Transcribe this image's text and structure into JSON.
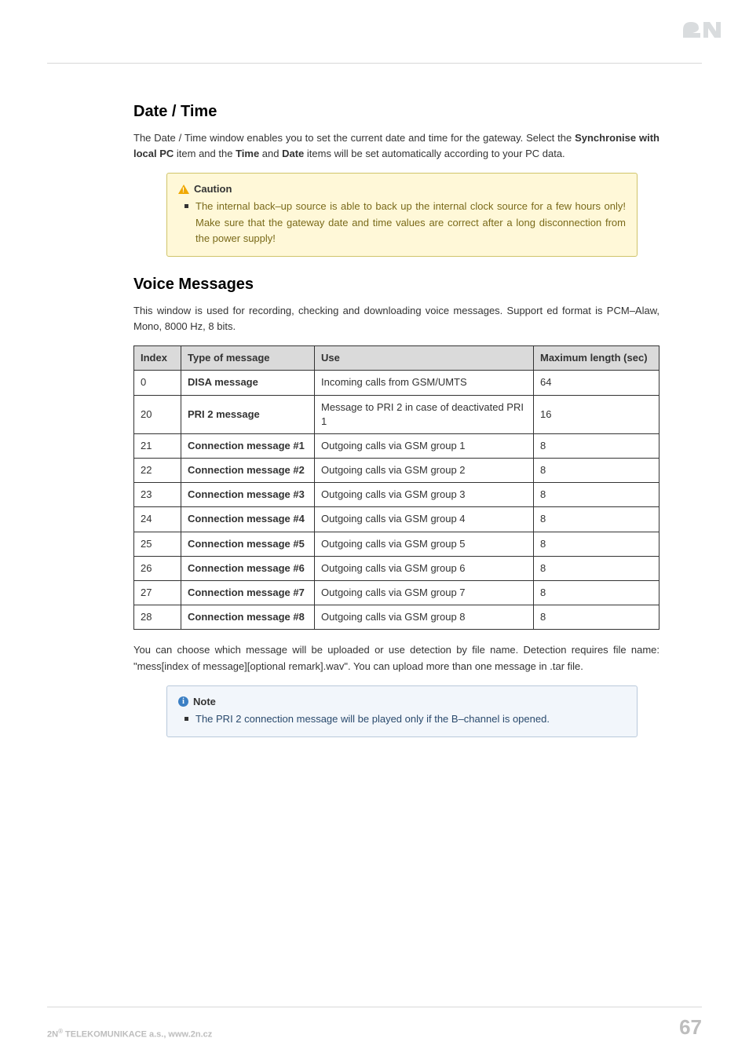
{
  "sections": {
    "date_time": {
      "heading": "Date / Time",
      "paragraph_parts": [
        "The Date / Time window enables you to set the current date and time for the gateway. Select the ",
        "Synchronise with local PC",
        " item and the ",
        "Time",
        " and ",
        "Date",
        " items will be set automatically according to your PC data."
      ],
      "caution": {
        "title": "Caution",
        "text": "The internal back–up source is able to back up the internal clock source for a few hours only! Make sure that the gateway date and time values are correct after a long disconnection from the power supply!"
      }
    },
    "voice_messages": {
      "heading": "Voice Messages",
      "paragraph": "This window is used for recording, checking and downloading voice messages. Support ed format is PCM–Alaw, Mono, 8000 Hz, 8 bits.",
      "table": {
        "headers": [
          "Index",
          "Type of message",
          "Use",
          "Maximum length (sec)"
        ],
        "rows": [
          {
            "index": "0",
            "type": "DISA message",
            "use": "Incoming calls from GSM/UMTS",
            "max": "64"
          },
          {
            "index": "20",
            "type": "PRI 2 message",
            "use": "Message to PRI 2 in case of deactivated PRI 1",
            "max": "16"
          },
          {
            "index": "21",
            "type": "Connection message #1",
            "use": "Outgoing calls via GSM group 1",
            "max": "8"
          },
          {
            "index": "22",
            "type": "Connection message #2",
            "use": "Outgoing calls via GSM group 2",
            "max": "8"
          },
          {
            "index": "23",
            "type": "Connection message #3",
            "use": "Outgoing calls via GSM group 3",
            "max": "8"
          },
          {
            "index": "24",
            "type": "Connection message #4",
            "use": "Outgoing calls via GSM group 4",
            "max": "8"
          },
          {
            "index": "25",
            "type": "Connection message #5",
            "use": "Outgoing calls via GSM group 5",
            "max": "8"
          },
          {
            "index": "26",
            "type": "Connection message #6",
            "use": "Outgoing calls via GSM group 6",
            "max": "8"
          },
          {
            "index": "27",
            "type": "Connection message #7",
            "use": "Outgoing calls via GSM group 7",
            "max": "8"
          },
          {
            "index": "28",
            "type": "Connection message #8",
            "use": "Outgoing calls via GSM group 8",
            "max": "8"
          }
        ]
      },
      "after_table": "You can choose which message will be uploaded or use detection by file name. Detection requires file name: \"mess[index of message][optional remark].wav\". You can upload more than one message in .tar file.",
      "note": {
        "title": "Note",
        "text": "The PRI 2 connection message will be played only if the B–channel is opened."
      }
    }
  },
  "footer": {
    "left_prefix": "2N",
    "left_sup": "®",
    "left_rest": " TELEKOMUNIKACE a.s., www.2n.cz",
    "page_number": "67"
  }
}
